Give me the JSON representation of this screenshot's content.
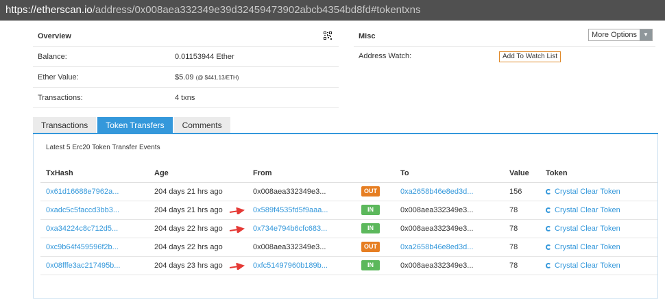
{
  "url": {
    "host_part": "https://etherscan.io",
    "path_part": "/address/0x008aea332349e39d32459473902abcb4354bd8fd#tokentxns"
  },
  "overview": {
    "title": "Overview",
    "rows": [
      {
        "label": "Balance:",
        "value": "0.01153944 Ether"
      },
      {
        "label": "Ether Value:",
        "value": "$5.09",
        "extra": "(@ $441.13/ETH)"
      },
      {
        "label": "Transactions:",
        "value": "4 txns"
      }
    ]
  },
  "misc": {
    "title": "Misc",
    "more_options": "More Options",
    "address_watch_label": "Address Watch:",
    "add_watch_button": "Add To Watch List"
  },
  "tabs": [
    {
      "label": "Transactions",
      "active": false
    },
    {
      "label": "Token Transfers",
      "active": true
    },
    {
      "label": "Comments",
      "active": false
    }
  ],
  "token_table": {
    "caption": "Latest 5 Erc20 Token Transfer Events",
    "headers": [
      "TxHash",
      "Age",
      "From",
      "",
      "To",
      "Value",
      "Token"
    ],
    "rows": [
      {
        "txhash": "0x61d16688e7962a...",
        "age": "204 days 21 hrs ago",
        "from": "0x008aea332349e3...",
        "from_link": false,
        "direction": "OUT",
        "to": "0xa2658b46e8ed3d...",
        "to_link": true,
        "value": "156",
        "token": "Crystal Clear Token",
        "arrow": false
      },
      {
        "txhash": "0xadc5c5faccd3bb3...",
        "age": "204 days 21 hrs ago",
        "from": "0x589f4535fd5f9aaa...",
        "from_link": true,
        "direction": "IN",
        "to": "0x008aea332349e3...",
        "to_link": false,
        "value": "78",
        "token": "Crystal Clear Token",
        "arrow": true
      },
      {
        "txhash": "0xa34224c8c712d5...",
        "age": "204 days 22 hrs ago",
        "from": "0x734e794b6cfc683...",
        "from_link": true,
        "direction": "IN",
        "to": "0x008aea332349e3...",
        "to_link": false,
        "value": "78",
        "token": "Crystal Clear Token",
        "arrow": true
      },
      {
        "txhash": "0xc9b64f459596f2b...",
        "age": "204 days 22 hrs ago",
        "from": "0x008aea332349e3...",
        "from_link": false,
        "direction": "OUT",
        "to": "0xa2658b46e8ed3d...",
        "to_link": true,
        "value": "78",
        "token": "Crystal Clear Token",
        "arrow": false
      },
      {
        "txhash": "0x08fffe3ac217495b...",
        "age": "204 days 23 hrs ago",
        "from": "0xfc51497960b189b...",
        "from_link": true,
        "direction": "IN",
        "to": "0x008aea332349e3...",
        "to_link": false,
        "value": "78",
        "token": "Crystal Clear Token",
        "arrow": true
      }
    ]
  },
  "colors": {
    "link": "#3498db",
    "out_badge": "#e67e22",
    "in_badge": "#5cb85c",
    "arrow": "#e53935"
  }
}
